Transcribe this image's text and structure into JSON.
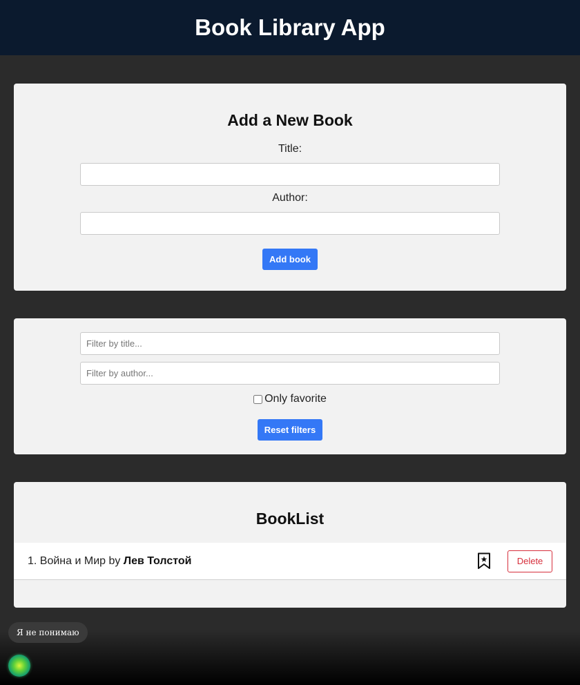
{
  "header": {
    "title": "Book Library App"
  },
  "add_form": {
    "heading": "Add a New Book",
    "title_label": "Title:",
    "title_value": "",
    "author_label": "Author:",
    "author_value": "",
    "submit_label": "Add book"
  },
  "filters": {
    "title_placeholder": "Filter by title...",
    "author_placeholder": "Filter by author...",
    "only_favorite_label": "Only favorite",
    "only_favorite_checked": false,
    "reset_label": "Reset filters"
  },
  "book_list": {
    "heading": "BookList",
    "items": [
      {
        "index": "1.",
        "title": "Война и Мир",
        "by": "by",
        "author": "Лев Толстой",
        "favorite_icon": "bookmark-star-icon",
        "delete_label": "Delete"
      }
    ]
  },
  "overlay": {
    "chat_bubble": "Я не понимаю",
    "assistant_icon": "assistant-orb-icon"
  },
  "colors": {
    "header_bg": "#0b1a2e",
    "page_bg": "#2b2b2b",
    "card_bg": "#f2f2f2",
    "primary": "#3478f6",
    "danger": "#d62e3b"
  }
}
